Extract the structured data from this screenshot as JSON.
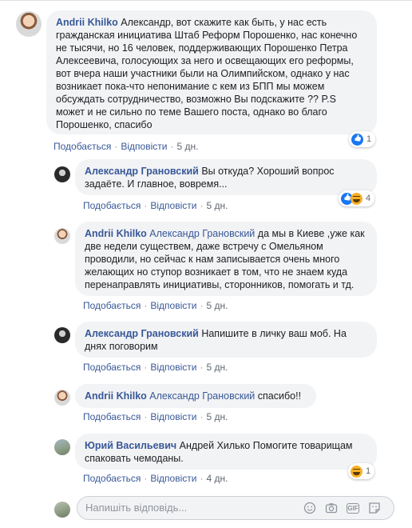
{
  "comments": [
    {
      "author": "Andrii Khilko",
      "text": "Александр, вот скажите как быть, у нас есть гражданская инициатива Штаб Реформ Порошенко, нас конечно не тысячи, но 16 человек, поддерживающих Порошенко Петра Алексеевича, голосующих за него и освещающих его реформы, вот вчера наши участники были на Олимпийском, однако у нас возникает пока-что непонимание с кем из БПП мы можем обсуждать сотрудничество, возможно Вы подскажите ?? P.S может и не сильно по теме Вашего поста, однако во благо Порошенко, спасибо",
      "like": "Подобається",
      "reply": "Відповісти",
      "time": "5 дн.",
      "reaction_count": "1"
    },
    {
      "author": "Александр Грановский",
      "text": "Вы откуда? Хороший вопрос задаёте. И главное, вовремя...",
      "like": "Подобається",
      "reply": "Відповісти",
      "time": "5 дн.",
      "reaction_count": "4"
    },
    {
      "author": "Andrii Khilko",
      "mention": "Александр Грановский",
      "text": "да мы в Киеве ,уже как две недели существем, даже встречу с Омельяном проводили, но сейчас к нам записывается очень много желающих но ступор возникает в том, что не знаем куда перенаправлять инициативы, сторонников, помогать и тд.",
      "like": "Подобається",
      "reply": "Відповісти",
      "time": "5 дн."
    },
    {
      "author": "Александр Грановский",
      "text": "Напишите в личку ваш моб. На днях поговорим",
      "like": "Подобається",
      "reply": "Відповісти",
      "time": "5 дн."
    },
    {
      "author": "Andrii Khilko",
      "mention": "Александр Грановский",
      "text": "спасибо!!",
      "like": "Подобається",
      "reply": "Відповісти",
      "time": "5 дн."
    },
    {
      "author": "Юрий Васильевич",
      "text": "Андрей Хилько Помогите товарищам спаковать чемоданы.",
      "like": "Подобається",
      "reply": "Відповісти",
      "time": "4 дн.",
      "reaction_count": "1"
    }
  ],
  "composer": {
    "placeholder": "Напишіть відповідь..."
  },
  "colors": {
    "link": "#385898",
    "bubble": "#f2f3f5",
    "like_blue": "#1877f2",
    "haha_yellow": "#f7b125"
  },
  "icons": [
    "like-reaction-icon",
    "haha-reaction-icon",
    "emoji-icon",
    "camera-icon",
    "gif-icon",
    "sticker-icon"
  ]
}
